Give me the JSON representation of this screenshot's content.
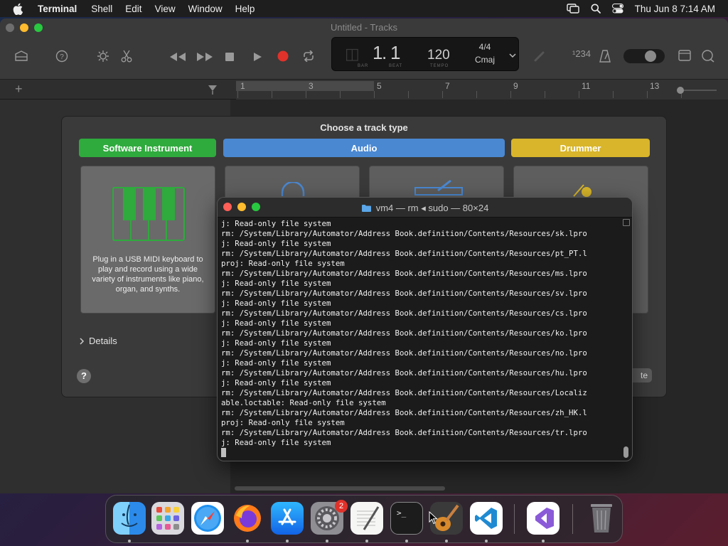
{
  "menubar": {
    "app_name": "Terminal",
    "items": [
      "Shell",
      "Edit",
      "View",
      "Window",
      "Help"
    ],
    "clock": "Thu Jun 8  7:14 AM"
  },
  "garageband": {
    "window_title": "Untitled - Tracks",
    "lcd": {
      "bar": "1",
      "beat": "1",
      "bar_label": "BAR",
      "beat_label": "BEAT",
      "tempo": "120",
      "tempo_label": "TEMPO",
      "time_signature": "4/4",
      "key": "Cmaj"
    },
    "count_in": "¹234",
    "ruler_numbers": [
      "1",
      "3",
      "5",
      "7",
      "9",
      "11",
      "13"
    ],
    "sheet": {
      "title": "Choose a track type",
      "types": [
        {
          "label": "Software Instrument",
          "color": "#2faa3d"
        },
        {
          "label": "Audio",
          "color": "#4a88d2"
        },
        {
          "label": "Drummer",
          "color": "#d8b52a"
        }
      ],
      "selected_description": "Plug in a USB MIDI keyboard to play and record using a wide variety of instruments like piano, organ, and synths.",
      "details_label": "Details",
      "help_label": "?",
      "create_label": "te"
    }
  },
  "terminal": {
    "title": "vm4 — rm ◂ sudo — 80×24",
    "lines": [
      "j: Read-only file system",
      "rm: /System/Library/Automator/Address Book.definition/Contents/Resources/sk.lpro",
      "j: Read-only file system",
      "rm: /System/Library/Automator/Address Book.definition/Contents/Resources/pt_PT.l",
      "proj: Read-only file system",
      "rm: /System/Library/Automator/Address Book.definition/Contents/Resources/ms.lpro",
      "j: Read-only file system",
      "rm: /System/Library/Automator/Address Book.definition/Contents/Resources/sv.lpro",
      "j: Read-only file system",
      "rm: /System/Library/Automator/Address Book.definition/Contents/Resources/cs.lpro",
      "j: Read-only file system",
      "rm: /System/Library/Automator/Address Book.definition/Contents/Resources/ko.lpro",
      "j: Read-only file system",
      "rm: /System/Library/Automator/Address Book.definition/Contents/Resources/no.lpro",
      "j: Read-only file system",
      "rm: /System/Library/Automator/Address Book.definition/Contents/Resources/hu.lpro",
      "j: Read-only file system",
      "rm: /System/Library/Automator/Address Book.definition/Contents/Resources/Localiz",
      "able.loctable: Read-only file system",
      "rm: /System/Library/Automator/Address Book.definition/Contents/Resources/zh_HK.l",
      "proj: Read-only file system",
      "rm: /System/Library/Automator/Address Book.definition/Contents/Resources/tr.lpro",
      "j: Read-only file system"
    ]
  },
  "dock": {
    "apps": [
      "Finder",
      "Launchpad",
      "Safari",
      "Firefox",
      "App Store",
      "System Settings",
      "TextEdit",
      "Terminal",
      "GarageBand",
      "Visual Studio Code",
      "Visual Studio",
      "Trash"
    ],
    "settings_badge": "2"
  },
  "colors": {
    "close": "#ff5f57",
    "minimize": "#febc2e",
    "zoom": "#28c840",
    "record": "#e0322a"
  }
}
